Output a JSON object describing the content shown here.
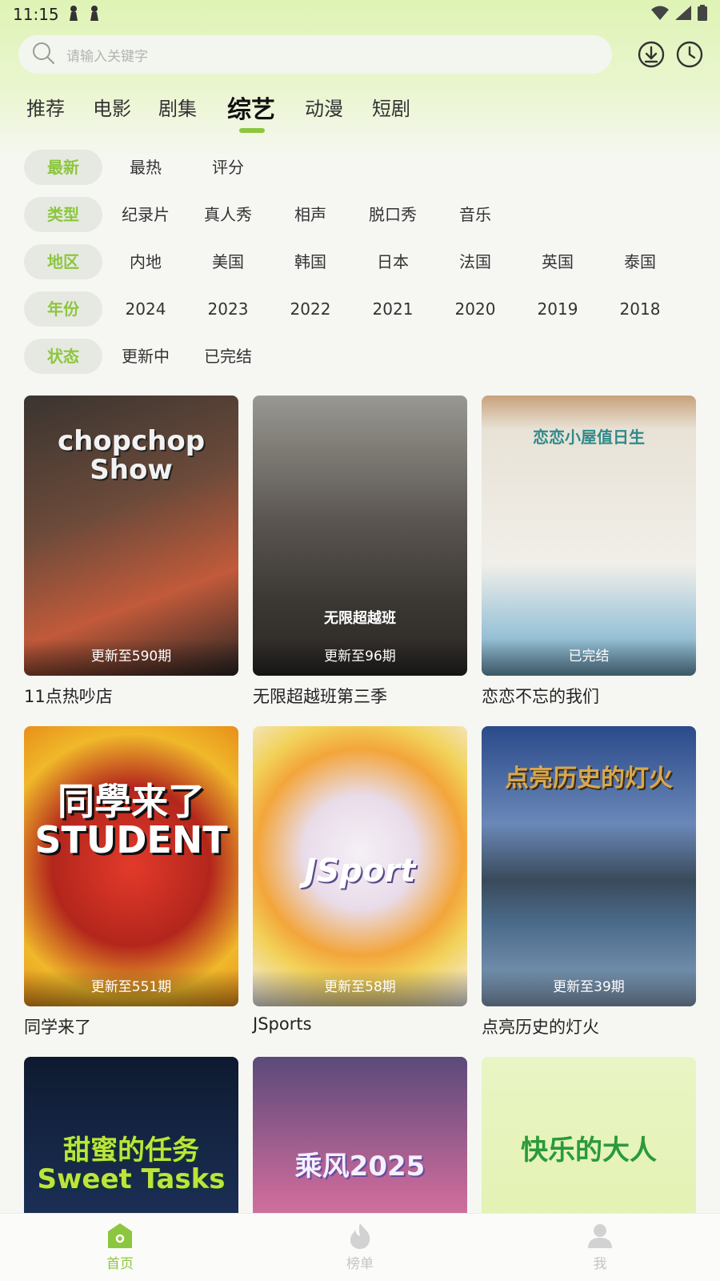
{
  "status_bar": {
    "time": "11:15"
  },
  "search": {
    "placeholder": "请输入关键字"
  },
  "tabs": [
    {
      "label": "推荐"
    },
    {
      "label": "电影"
    },
    {
      "label": "剧集"
    },
    {
      "label": "综艺"
    },
    {
      "label": "动漫"
    },
    {
      "label": "短剧"
    }
  ],
  "active_tab": "综艺",
  "filters": {
    "sort": {
      "options": [
        "最新",
        "最热",
        "评分"
      ],
      "selected": "最新"
    },
    "type": {
      "label": "类型",
      "options": [
        "纪录片",
        "真人秀",
        "相声",
        "脱口秀",
        "音乐"
      ]
    },
    "region": {
      "label": "地区",
      "options": [
        "内地",
        "美国",
        "韩国",
        "日本",
        "法国",
        "英国",
        "泰国"
      ]
    },
    "year": {
      "label": "年份",
      "options": [
        "2024",
        "2023",
        "2022",
        "2021",
        "2020",
        "2019",
        "2018"
      ]
    },
    "status": {
      "label": "状态",
      "options": [
        "更新中",
        "已完结"
      ]
    }
  },
  "items": [
    {
      "title": "11点热吵店",
      "badge": "更新至590期",
      "art": "chopchop Show"
    },
    {
      "title": "无限超越班第三季",
      "badge": "更新至96期",
      "art": "无限超越班"
    },
    {
      "title": "恋恋不忘的我们",
      "badge": "已完结",
      "art": "恋恋小屋值日生"
    },
    {
      "title": "同学来了",
      "badge": "更新至551期",
      "art": "同學来了 STUDENT"
    },
    {
      "title": "JSports",
      "badge": "更新至58期",
      "art": "JSport"
    },
    {
      "title": "点亮历史的灯火",
      "badge": "更新至39期",
      "art": "点亮历史的灯火"
    },
    {
      "title": "",
      "badge": "",
      "art": "甜蜜的任务 Sweet Tasks"
    },
    {
      "title": "",
      "badge": "",
      "art": "乘风2025"
    },
    {
      "title": "",
      "badge": "",
      "art": "快乐的大人"
    }
  ],
  "bottom_nav": [
    {
      "label": "首页",
      "icon": "home-icon",
      "active": true
    },
    {
      "label": "榜单",
      "icon": "flame-icon",
      "active": false
    },
    {
      "label": "我",
      "icon": "user-icon",
      "active": false
    }
  ],
  "colors": {
    "accent": "#8cc63f",
    "chip_bg": "#e6e9e1",
    "header_tint": "#dff3b5"
  }
}
